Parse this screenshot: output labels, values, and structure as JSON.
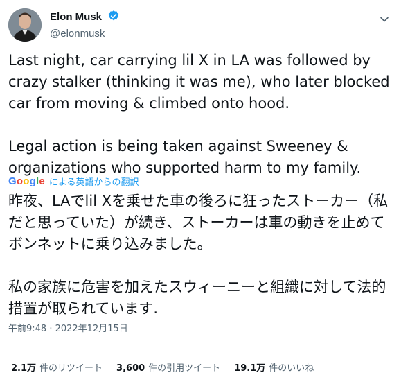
{
  "author": {
    "display_name": "Elon Musk",
    "handle": "@elonmusk",
    "verified_icon": "verified-badge-icon",
    "avatar": "profile-photo",
    "menu_icon": "more-caret-icon"
  },
  "tweet": {
    "text": "Last night, car carrying lil X in LA was followed by crazy stalker (thinking it was me), who later blocked car from moving & climbed onto hood.\n\nLegal action is being taken against Sweeney & organizations who supported harm to my family."
  },
  "translation": {
    "provider": "Google",
    "label": "による英語からの翻訳",
    "text": "昨夜、LAでlil Xを乗せた車の後ろに狂ったストーカー（私だと思っていた）が続き、ストーカーは車の動きを止めてボンネットに乗り込みました。\n\n私の家族に危害を加えたスウィーニーと組織に対して法的措置が取られています."
  },
  "meta": {
    "timestamp": "午前9:48 · 2022年12月15日"
  },
  "stats": {
    "retweets_count": "2.1万",
    "retweets_label": "件のリツイート",
    "quotes_count": "3,600",
    "quotes_label": "件の引用ツイート",
    "likes_count": "19.1万",
    "likes_label": "件のいいね"
  },
  "colors": {
    "accent": "#1d9bf0",
    "text": "#0f1419",
    "secondary": "#536471",
    "divider": "#eff3f4"
  }
}
